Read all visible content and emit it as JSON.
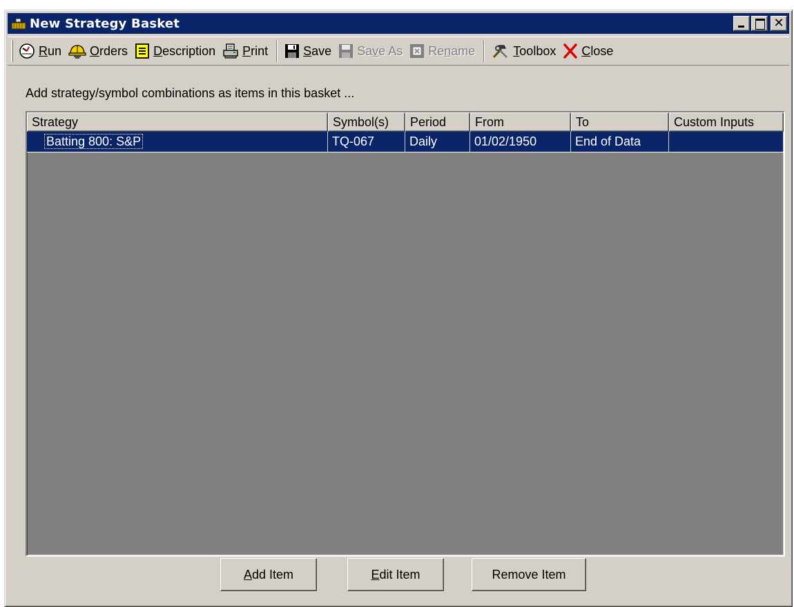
{
  "window": {
    "title": "New Strategy Basket",
    "title_icon": "basket-icon"
  },
  "toolbar": {
    "items": [
      {
        "label": "Run",
        "mnemonic": "R",
        "rest": "un",
        "icon": "gauge-icon",
        "disabled": false
      },
      {
        "label": "Orders",
        "mnemonic": "O",
        "rest": "rders",
        "icon": "hardhat-icon",
        "disabled": false
      },
      {
        "label": "Description",
        "mnemonic": "D",
        "rest": "escription",
        "icon": "notepad-icon",
        "disabled": false
      },
      {
        "label": "Print",
        "mnemonic": "P",
        "rest": "rint",
        "icon": "printer-icon",
        "disabled": false
      },
      {
        "label": "Save",
        "mnemonic": "S",
        "rest": "ave",
        "icon": "floppy-icon",
        "disabled": false
      },
      {
        "label": "Save As",
        "pre": "Sa",
        "mnemonic": "v",
        "rest": "e As",
        "icon": "floppy-icon",
        "disabled": true
      },
      {
        "label": "Rename",
        "pre": "Re",
        "mnemonic": "n",
        "rest": "ame",
        "icon": "rename-icon",
        "disabled": true
      },
      {
        "label": "Toolbox",
        "mnemonic": "T",
        "rest": "oolbox",
        "icon": "tools-icon",
        "disabled": false
      },
      {
        "label": "Close",
        "mnemonic": "C",
        "rest": "lose",
        "icon": "close-x-icon",
        "disabled": false
      }
    ]
  },
  "instruction": "Add strategy/symbol combinations as items in this basket ...",
  "list": {
    "columns": [
      "Strategy",
      "Symbol(s)",
      "Period",
      "From",
      "To",
      "Custom Inputs"
    ],
    "rows": [
      {
        "strategy": "Batting 800: S&P",
        "symbols": "TQ-067",
        "period": "Daily",
        "from": "01/02/1950",
        "to": "End of Data",
        "custom_inputs": ""
      }
    ]
  },
  "buttons": {
    "add": {
      "mnemonic": "A",
      "rest": "dd Item"
    },
    "edit": {
      "mnemonic": "E",
      "rest": "dit Item"
    },
    "remove": {
      "label": "Remove Item"
    }
  },
  "colors": {
    "titlebar": "#0a246a",
    "selection": "#0a246a",
    "face": "#d4d0c8",
    "list_bg": "#808080"
  }
}
